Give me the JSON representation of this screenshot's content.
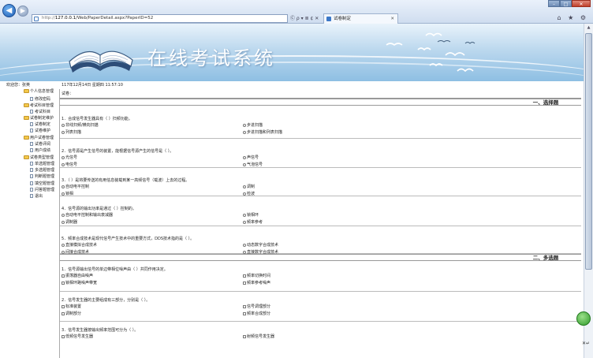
{
  "browser": {
    "back_glyph": "◀",
    "forward_glyph": "▶",
    "url_scheme": "http://",
    "url_host": "127.0.0.1",
    "url_path": "/Web/PaperDetail.aspx?PaperID=52",
    "addr_tools": "Ⓒ ρ ▾ ≣ ¢ ✕",
    "tab_title": "试卷制定",
    "tab_close": "✕",
    "right_tools": "⌂ ★ ⚙",
    "win_min": "–",
    "win_max": "□",
    "win_close": "✕"
  },
  "banner": {
    "title": "在线考试系统"
  },
  "status": {
    "welcome": "欢迎您：张英",
    "datetime": "117年12月14日 星期四 11:57:10"
  },
  "sidebar": {
    "items": [
      {
        "label": "个人信息管理",
        "type": "folder"
      },
      {
        "label": "修改密码",
        "type": "doc"
      },
      {
        "label": "考试科目管理",
        "type": "folder"
      },
      {
        "label": "考试科目",
        "type": "doc"
      },
      {
        "label": "试卷制定维护",
        "type": "folder"
      },
      {
        "label": "试卷制定",
        "type": "doc"
      },
      {
        "label": "试卷维护",
        "type": "doc"
      },
      {
        "label": "用户试卷管理",
        "type": "folder"
      },
      {
        "label": "试卷评阅",
        "type": "doc"
      },
      {
        "label": "用户成绩",
        "type": "doc"
      },
      {
        "label": "试卷类型管理",
        "type": "folder"
      },
      {
        "label": "单选题管理",
        "type": "doc"
      },
      {
        "label": "多选题管理",
        "type": "doc"
      },
      {
        "label": "判断题管理",
        "type": "doc"
      },
      {
        "label": "填空题管理",
        "type": "doc"
      },
      {
        "label": "问答题管理",
        "type": "doc"
      },
      {
        "label": "退出",
        "type": "doc"
      }
    ]
  },
  "paper": {
    "label": "试卷：",
    "sections": [
      {
        "title": "一、选择题",
        "kind": "radio",
        "questions": [
          {
            "stem": "1．合成信号发生器具有（ ）扫频功能。",
            "options": [
              "非线扫频/横向扫描",
              "步进扫描",
              "列表扫描",
              "步进扫描和列表扫描"
            ]
          },
          {
            "stem": "2．信号源是产生信号的装置，能根据信号源产生的信号是（ ）。",
            "options": [
              "光信号",
              "声信号",
              "电信号",
              "气泡信号"
            ]
          },
          {
            "stem": "3．（ ）是将要传送的有用信息装载到某一高频信号（载波）上去的过程。",
            "options": [
              "自动电平控制",
              "调制",
              "锁相",
              "检波"
            ]
          },
          {
            "stem": "4．信号源的输出功率是通过（ ）控制的。",
            "options": [
              "自动电平控制和输出衰减器",
              "锁相环",
              "调制器",
              "频率参考"
            ]
          },
          {
            "stem": "5．频率合成技术是现代信号产生技术中的重要方式，DDS技术指的是（ ）。",
            "options": [
              "直接模拟合成技术",
              "动态数字合成技术",
              "间接合成技术",
              "直接数字合成技术"
            ]
          }
        ]
      },
      {
        "title": "二、多选题",
        "kind": "check",
        "questions": [
          {
            "stem": "1．信号源输出信号的单边带相位噪声由（ ）共同作用决定。",
            "options": [
              "振荡器自由噪声",
              "频率切换时间",
              "锁相环路噪声带宽",
              "频率参考噪声"
            ]
          },
          {
            "stem": "2．信号发生器的主要组成有三部分，分别是（ ）。",
            "options": [
              "标准装置",
              "信号调理部分",
              "调制部分",
              "频率合成部分"
            ]
          },
          {
            "stem": "3．信号发生器按输出频率范围可分为（ ）。",
            "options": [
              "低频信号发生器",
              "射频信号发生器"
            ]
          }
        ]
      }
    ]
  },
  "scroll_up_glyph": "▲",
  "corner_mark": "✕↵"
}
